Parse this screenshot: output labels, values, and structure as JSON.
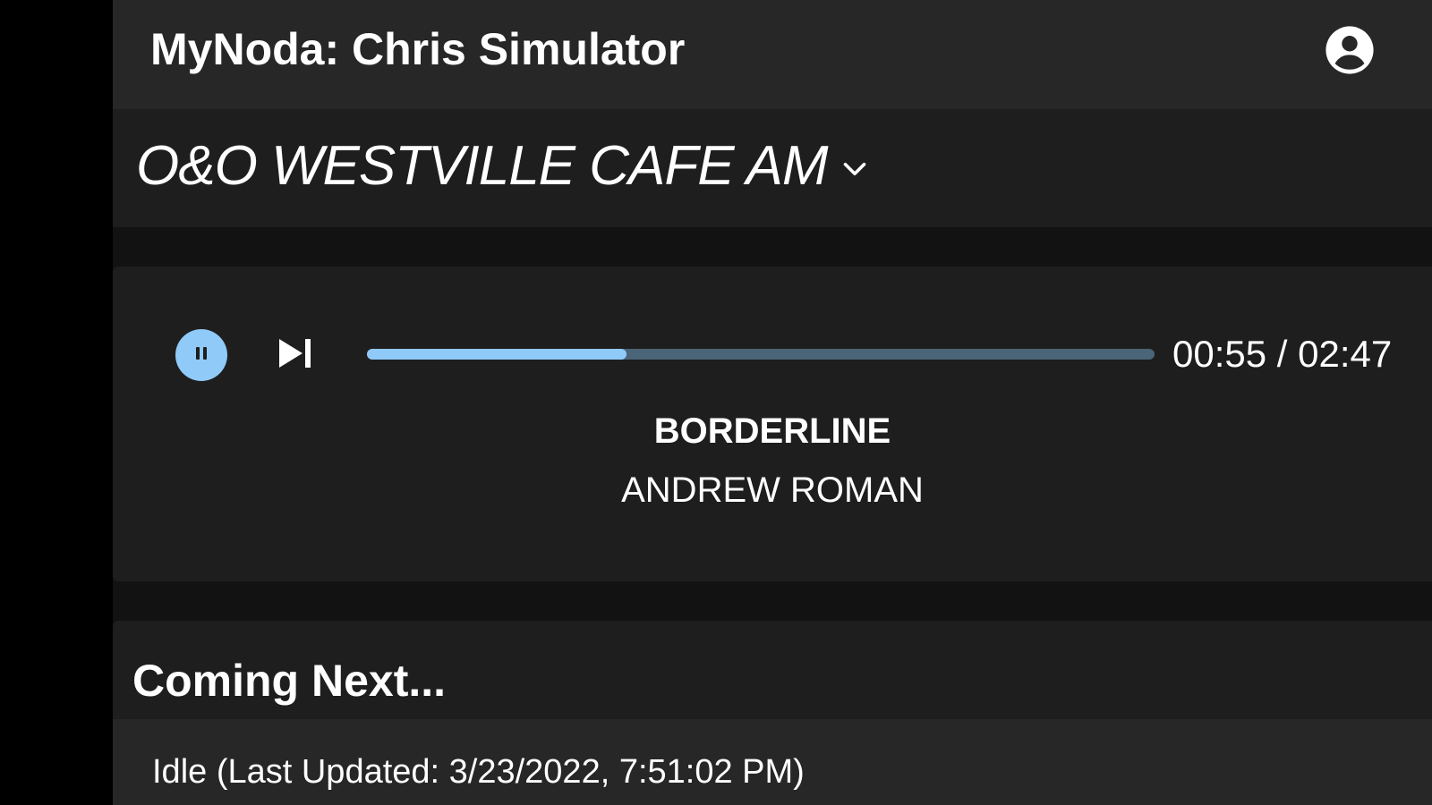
{
  "header": {
    "title": "MyNoda: Chris Simulator",
    "account_icon": "account-circle-icon"
  },
  "station": {
    "selected": "O&O WESTVILLE CAFE AM",
    "dropdown_icon": "chevron-down-icon"
  },
  "player": {
    "state": "playing",
    "pause_icon": "pause-icon",
    "skip_icon": "skip-next-icon",
    "elapsed": "00:55",
    "duration": "02:47",
    "time_display": "00:55 / 02:47",
    "progress_fraction": 0.329,
    "track_title": "BORDERLINE",
    "track_artist": "ANDREW ROMAN"
  },
  "coming_next": {
    "heading": "Coming Next...",
    "status": "Idle (Last Updated: 3/23/2022, 7:51:02 PM)"
  },
  "colors": {
    "accent": "#90caf9",
    "track_remaining": "#4a6478",
    "surface": "#1e1e1e",
    "app_bar": "#272727",
    "background": "#121212"
  }
}
